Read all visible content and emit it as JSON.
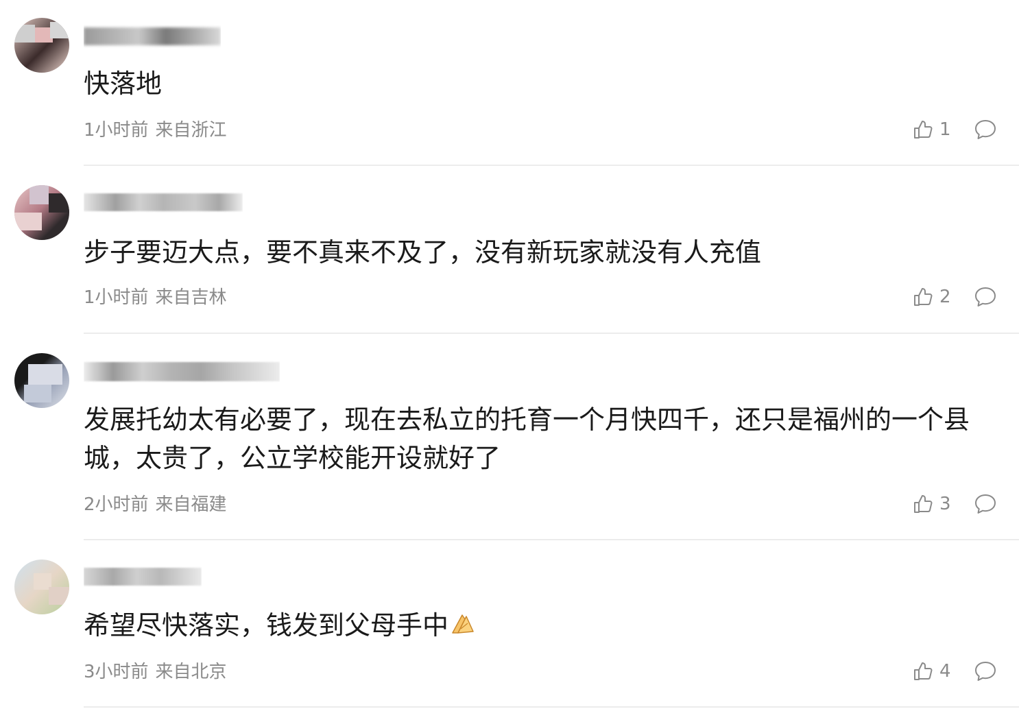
{
  "comments": [
    {
      "username": "",
      "text": "快落地",
      "time": "1小时前",
      "location": "来自浙江",
      "likes": "1",
      "avatar_colors": [
        "#d9b7b0",
        "#3b2b2b",
        "#f0d8d0"
      ]
    },
    {
      "username": "",
      "text": "步子要迈大点，要不真来不及了，没有新玩家就没有人充值",
      "time": "1小时前",
      "location": "来自吉林",
      "likes": "2",
      "avatar_colors": [
        "#e8c7c7",
        "#2f2a2c",
        "#b47b86"
      ]
    },
    {
      "username": "",
      "text": "发展托幼太有必要了，现在去私立的托育一个月快四千，还只是福州的一个县城，太贵了，公立学校能开设就好了",
      "time": "2小时前",
      "location": "来自福建",
      "likes": "3",
      "avatar_colors": [
        "#1a1a1a",
        "#dfe2ea",
        "#9aa3b8"
      ]
    },
    {
      "username": "",
      "text": "希望尽快落实，钱发到父母手中",
      "emoji": "folded-hands-emoji",
      "time": "3小时前",
      "location": "来自北京",
      "likes": "4",
      "avatar_colors": [
        "#cfe1ee",
        "#e6d6c6",
        "#b9cf9d"
      ]
    }
  ],
  "colors": {
    "meta_text": "#8a8a8a",
    "body_text": "#1a1a1a",
    "divider": "#ececec"
  }
}
